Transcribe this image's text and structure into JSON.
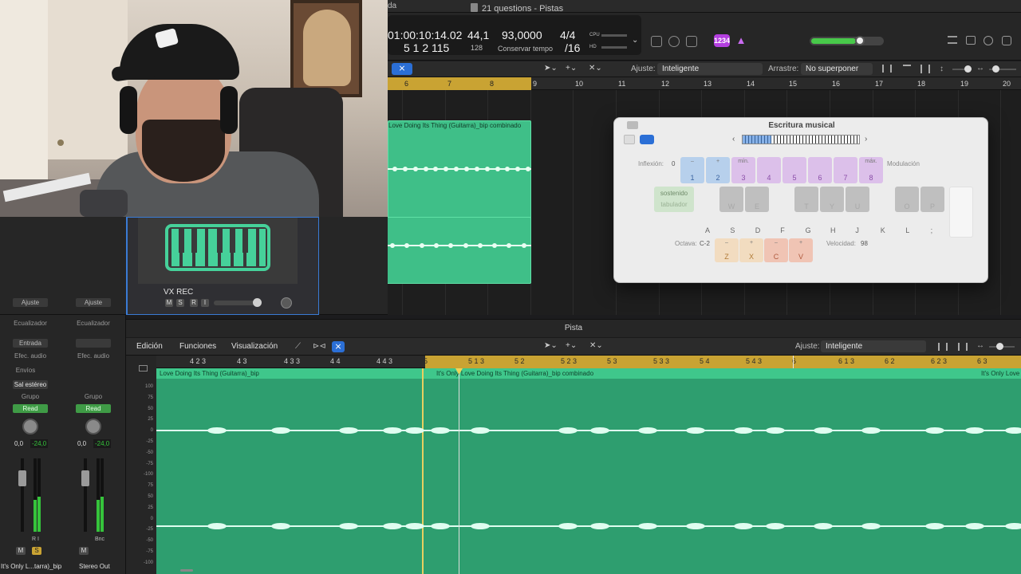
{
  "window": {
    "title": "21 questions - Pistas",
    "top_hint": "da"
  },
  "lcd": {
    "time": "01:00:10:14.02",
    "bars": "5  1  2  115",
    "tempo_a": "44,1",
    "tempo_a_sub": "128",
    "tempo": "93,0000",
    "tempo_mode": "Conservar tempo",
    "signature": "4/4",
    "division": "/16",
    "cpu": "CPU",
    "hd": "HD"
  },
  "badge_count": "1234",
  "tracks_toolbar": {
    "snap_label": "Ajuste:",
    "snap_value": "Inteligente",
    "drag_label": "Arrastre:",
    "drag_value": "No superponer"
  },
  "top_ruler": [
    "6",
    "7",
    "8",
    "9",
    "10",
    "11",
    "12",
    "13",
    "14",
    "15",
    "16",
    "17",
    "18",
    "19",
    "20"
  ],
  "regions": {
    "upper_name": "Love Doing Its Thing (Guitarra)_bip combinado"
  },
  "track": {
    "name": "VX REC",
    "buttons": [
      "M",
      "S",
      "R",
      "I"
    ]
  },
  "musical_typing": {
    "title": "Escritura musical",
    "pitch_label": "Inflexión:",
    "pitch_value": "0",
    "modulation_label": "Modulación",
    "sustain_label": "sostenido",
    "tab_label": "tabulador",
    "octave_label": "Octava:",
    "octave_value": "C-2",
    "velocity_label": "Velocidad:",
    "velocity_value": "98",
    "pitch_keys": [
      {
        "top": "–",
        "bottom": "1"
      },
      {
        "top": "+",
        "bottom": "2"
      },
      {
        "top": "mín.",
        "bottom": "3"
      },
      {
        "top": "",
        "bottom": "4"
      },
      {
        "top": "",
        "bottom": "5"
      },
      {
        "top": "",
        "bottom": "6"
      },
      {
        "top": "",
        "bottom": "7"
      },
      {
        "top": "máx.",
        "bottom": "8"
      }
    ],
    "black_keys": [
      "W",
      "E",
      "T",
      "Y",
      "U",
      "O",
      "P"
    ],
    "white_keys": [
      "A",
      "S",
      "D",
      "F",
      "G",
      "H",
      "J",
      "K",
      "L",
      ";",
      "'"
    ],
    "oct_keys": [
      {
        "top": "–",
        "bottom": "Z"
      },
      {
        "top": "+",
        "bottom": "X"
      },
      {
        "top": "–",
        "bottom": "C"
      },
      {
        "top": "+",
        "bottom": "V"
      }
    ]
  },
  "mixer": {
    "strips": [
      {
        "setting": "Ajuste",
        "eq": "Ecualizador",
        "input": "Entrada",
        "fx": "Efec. audio",
        "sends": "Envíos",
        "output": "Sal estéreo",
        "group": "Grupo",
        "auto": "Read",
        "vol": "0,0",
        "peak": "-24,0",
        "buttons": [
          "M",
          "S"
        ],
        "ri": "R  I",
        "name": "It's Only L...tarra)_bip"
      },
      {
        "setting": "Ajuste",
        "eq": "Ecualizador",
        "input": "",
        "fx": "Efec. audio",
        "sends": "",
        "output": "",
        "group": "Grupo",
        "auto": "Read",
        "vol": "0,0",
        "peak": "-24,0",
        "buttons": [
          "M"
        ],
        "ri": "Bnc",
        "name": "Stereo Out"
      }
    ]
  },
  "editor": {
    "title": "Pista",
    "menus": [
      "Edición",
      "Funciones",
      "Visualización"
    ],
    "snap_label": "Ajuste:",
    "snap_value": "Inteligente",
    "ruler": [
      {
        "label": "4 2 3"
      },
      {
        "label": "4 3"
      },
      {
        "label": "4 3 3"
      },
      {
        "label": "4 4"
      },
      {
        "label": "4 4 3"
      },
      {
        "label": "5"
      },
      {
        "label": "5 1 3"
      },
      {
        "label": "5 2"
      },
      {
        "label": "5 2 3"
      },
      {
        "label": "5 3"
      },
      {
        "label": "5 3 3"
      },
      {
        "label": "5 4"
      },
      {
        "label": "5 4 3"
      },
      {
        "label": "6"
      },
      {
        "label": "6 1 3"
      },
      {
        "label": "6 2"
      },
      {
        "label": "6 2 3"
      },
      {
        "label": "6 3"
      }
    ],
    "region_left": "Love Doing Its Thing (Guitarra)_bip",
    "region_mid": "It's Only Love Doing Its Thing (Guitarra)_bip combinado",
    "region_right": "It's Only Love",
    "amplitude": [
      "100",
      "75",
      "50",
      "25",
      "0",
      "-25",
      "-50",
      "-75",
      "-100",
      "75",
      "50",
      "25",
      "0",
      "-25",
      "-50",
      "-75",
      "-100"
    ]
  },
  "colors": {
    "region_green": "#3fbf88",
    "cycle_yellow": "#c9a333",
    "selection_blue": "#2b6fd6",
    "badge_purple": "#b43fe0"
  }
}
